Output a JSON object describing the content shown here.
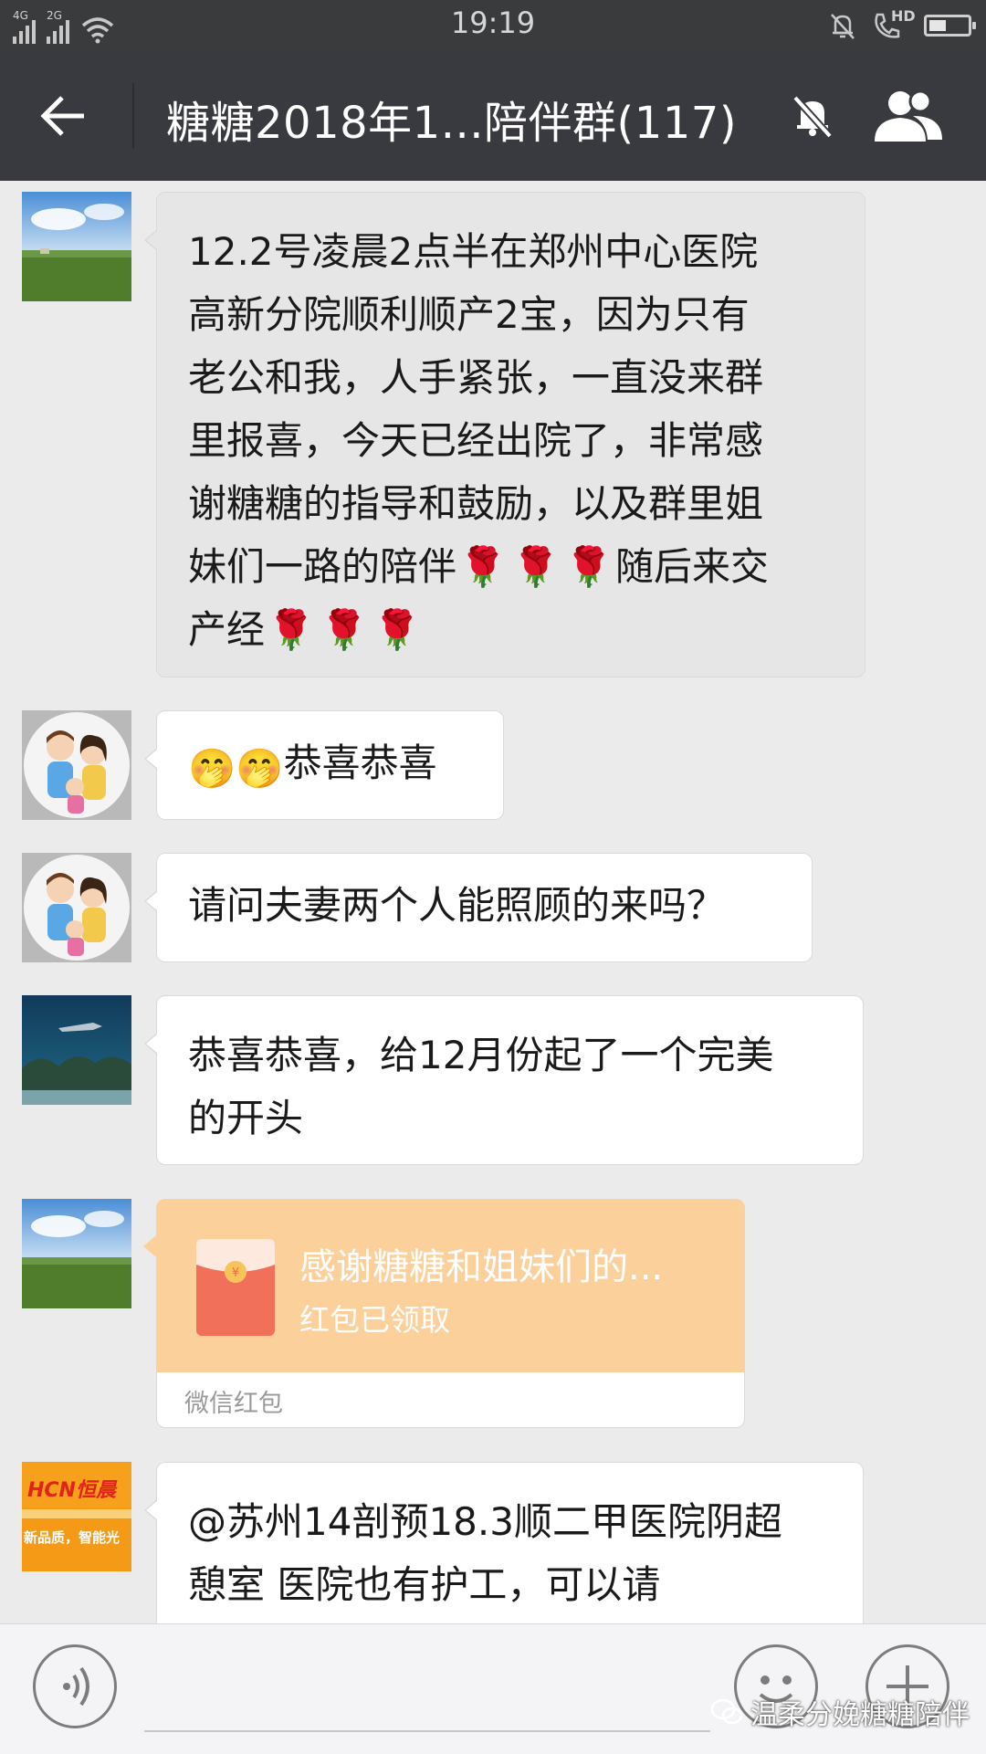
{
  "status_bar": {
    "time": "19:19",
    "network_1": "4G",
    "network_2": "2G",
    "right_label": "HD",
    "battery_level": 0.45
  },
  "header": {
    "title": "糖糖2018年1...陪伴群(117)",
    "icons": [
      "back-arrow-icon",
      "mute-bell-icon",
      "group-members-icon"
    ]
  },
  "messages": [
    {
      "type": "text",
      "avatar": "landscape-avatar",
      "lines": [
        "12.2号凌晨2点半在郑州中心医院",
        "高新分院顺利顺产2宝，因为只有",
        "老公和我，人手紧张，一直没来群",
        "里报喜，今天已经出院了，非常感",
        "谢糖糖的指导和鼓励，以及群里姐",
        "妹们一路的陪伴🌹🌹🌹随后来交",
        "产经🌹🌹🌹"
      ],
      "line_parts": {
        "l6": "妹们一路的陪伴",
        "l6_tail": "随后来交",
        "l7": "产经"
      }
    },
    {
      "type": "text",
      "avatar": "family-cartoon-avatar",
      "text": "恭喜恭喜",
      "emoji_prefix": "🤭🤭"
    },
    {
      "type": "text",
      "avatar": "family-cartoon-avatar",
      "text": "请问夫妻两个人能照顾的来吗？"
    },
    {
      "type": "text",
      "avatar": "aquarium-avatar",
      "lines": [
        "恭喜恭喜，给12月份起了一个完美",
        "的开头"
      ]
    },
    {
      "type": "red_packet",
      "avatar": "landscape-avatar",
      "title": "感谢糖糖和姐妹们的...",
      "status": "红包已领取",
      "label": "微信红包"
    },
    {
      "type": "text",
      "avatar": "hcn-logo-avatar",
      "lines": [
        "@苏州14剖预18.3顺二甲医院阴超",
        "憩室 医院也有护工，可以请"
      ]
    }
  ],
  "avatar_text": {
    "hcn_logo": "HCN恒晨",
    "hcn_slogan": "新品质，智能光"
  },
  "input_bar": {
    "watermark": "温柔分娩糖糖陪伴"
  },
  "colors": {
    "chat_bg": "#ebebeb",
    "header_bg": "#393a3f",
    "red_packet": "#fcd09a",
    "bubble": "#ffffff"
  }
}
